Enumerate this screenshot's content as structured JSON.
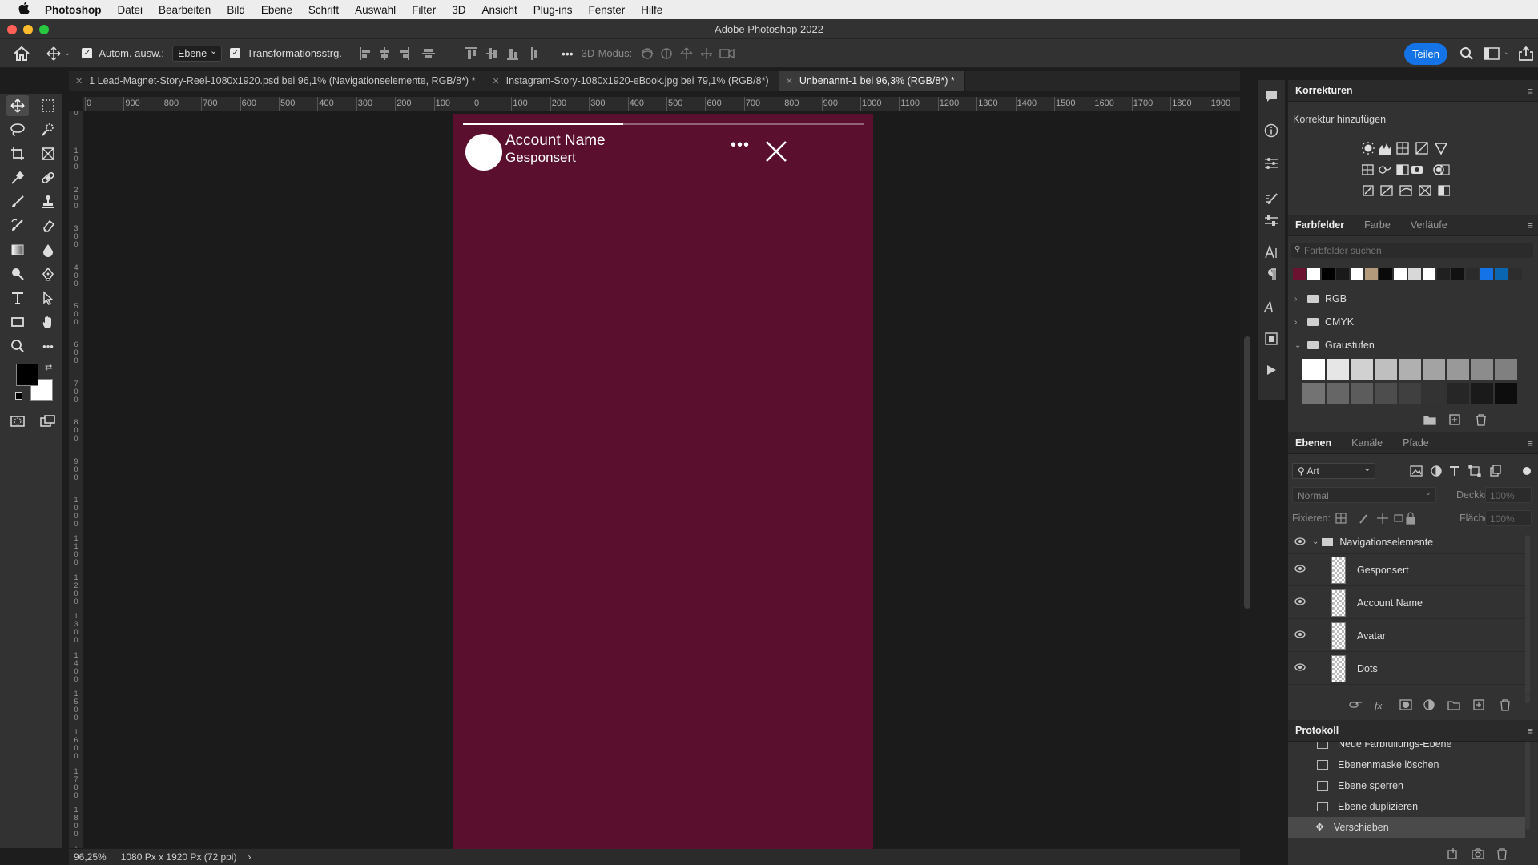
{
  "menubar": {
    "apple": "",
    "items": [
      "Photoshop",
      "Datei",
      "Bearbeiten",
      "Bild",
      "Ebene",
      "Schrift",
      "Auswahl",
      "Filter",
      "3D",
      "Ansicht",
      "Plug-ins",
      "Fenster",
      "Hilfe"
    ]
  },
  "window": {
    "title": "Adobe Photoshop 2022"
  },
  "options": {
    "auto_select_label": "Autom. ausw.:",
    "auto_select_target": "Ebene",
    "transform_label": "Transformationsstrg.",
    "more": "•••",
    "mode3d_label": "3D-Modus:",
    "share_label": "Teilen"
  },
  "tabs": [
    {
      "label": "1 Lead-Magnet-Story-Reel-1080x1920.psd bei 96,1% (Navigationselemente, RGB/8*) *"
    },
    {
      "label": "Instagram-Story-1080x1920-eBook.jpg bei 79,1% (RGB/8*)"
    },
    {
      "label": "Unbenannt-1 bei 96,3% (RGB/8*) *"
    }
  ],
  "ruler": {
    "top_ticks": [
      "0",
      "900",
      "800",
      "700",
      "600",
      "500",
      "400",
      "300",
      "200",
      "100",
      "0",
      "100",
      "200",
      "300",
      "400",
      "500",
      "600",
      "700",
      "800",
      "900",
      "1000",
      "1100",
      "1200",
      "1300",
      "1400",
      "1500",
      "1600",
      "1700",
      "1800",
      "1900",
      "200"
    ],
    "left_ticks": [
      "0",
      "1\n0\n0",
      "2\n0\n0",
      "3\n0\n0",
      "4\n0\n0",
      "5\n0\n0",
      "6\n0\n0",
      "7\n0\n0",
      "8\n0\n0",
      "9\n0\n0",
      "1\n0\n0\n0",
      "1\n1\n0\n0",
      "1\n2\n0\n0",
      "1\n3\n0\n0",
      "1\n4\n0\n0",
      "1\n5\n0\n0",
      "1\n6\n0\n0",
      "1\n7\n0\n0",
      "1\n8\n0\n0",
      "1\n9\n0\n0"
    ]
  },
  "artboard": {
    "account_name": "Account Name",
    "sponsored": "Gesponsert",
    "dots": "•••",
    "progress_fraction": 0.4,
    "background": "#5b0f2e"
  },
  "status": {
    "zoom": "96,25%",
    "size": "1080 Px x 1920 Px (72 ppi)",
    "arrow": "›"
  },
  "panels": {
    "korrekturen": {
      "title": "Korrekturen",
      "add_label": "Korrektur hinzufügen"
    },
    "farbfelder": {
      "tabs": [
        "Farbfelder",
        "Farbe",
        "Verläufe"
      ],
      "search_placeholder": "Farbfelder suchen",
      "swatches": [
        "#6b1230",
        "#ffffff",
        "#000000",
        "#1a1a1a",
        "#ffffff",
        "#b39a7a",
        "#0a0a0a",
        "#ffffff",
        "#d8d8d8",
        "#ffffff",
        "#202020",
        "#111111",
        "#2b2b2b",
        "#1473e6",
        "#0a66b0",
        "#2d2d2d"
      ],
      "folders": [
        "RGB",
        "CMYK",
        "Graustufen"
      ],
      "grays": [
        "#ffffff",
        "#e6e6e6",
        "#d1d1d1",
        "#bfbfbf",
        "#b0b0b0",
        "#a3a3a3",
        "#999999",
        "#8c8c8c",
        "#808080",
        "#737373",
        "#666666",
        "#5c5c5c",
        "#4d4d4d",
        "#404040",
        "#333333",
        "#262626",
        "#1a1a1a",
        "#0d0d0d"
      ]
    },
    "ebenen": {
      "tabs": [
        "Ebenen",
        "Kanäle",
        "Pfade"
      ],
      "filter_label": "Art",
      "blend_mode": "Normal",
      "opacity_label": "Deckkraft:",
      "opacity_value": "100%",
      "lock_label": "Fixieren:",
      "fill_label": "Fläche:",
      "fill_value": "100%",
      "group_name": "Navigationselemente",
      "layers": [
        "Gesponsert",
        "Account Name",
        "Avatar",
        "Dots"
      ]
    },
    "protokoll": {
      "title": "Protokoll",
      "items": [
        "Neue Farbfüllungs-Ebene",
        "Ebenenmaske löschen",
        "Ebene sperren",
        "Ebene duplizieren",
        "Verschieben"
      ]
    }
  },
  "icons": {
    "home": "home-icon",
    "move": "move-tool-icon",
    "search": "search-icon",
    "workspace": "workspace-icon",
    "share": "share-icon"
  }
}
